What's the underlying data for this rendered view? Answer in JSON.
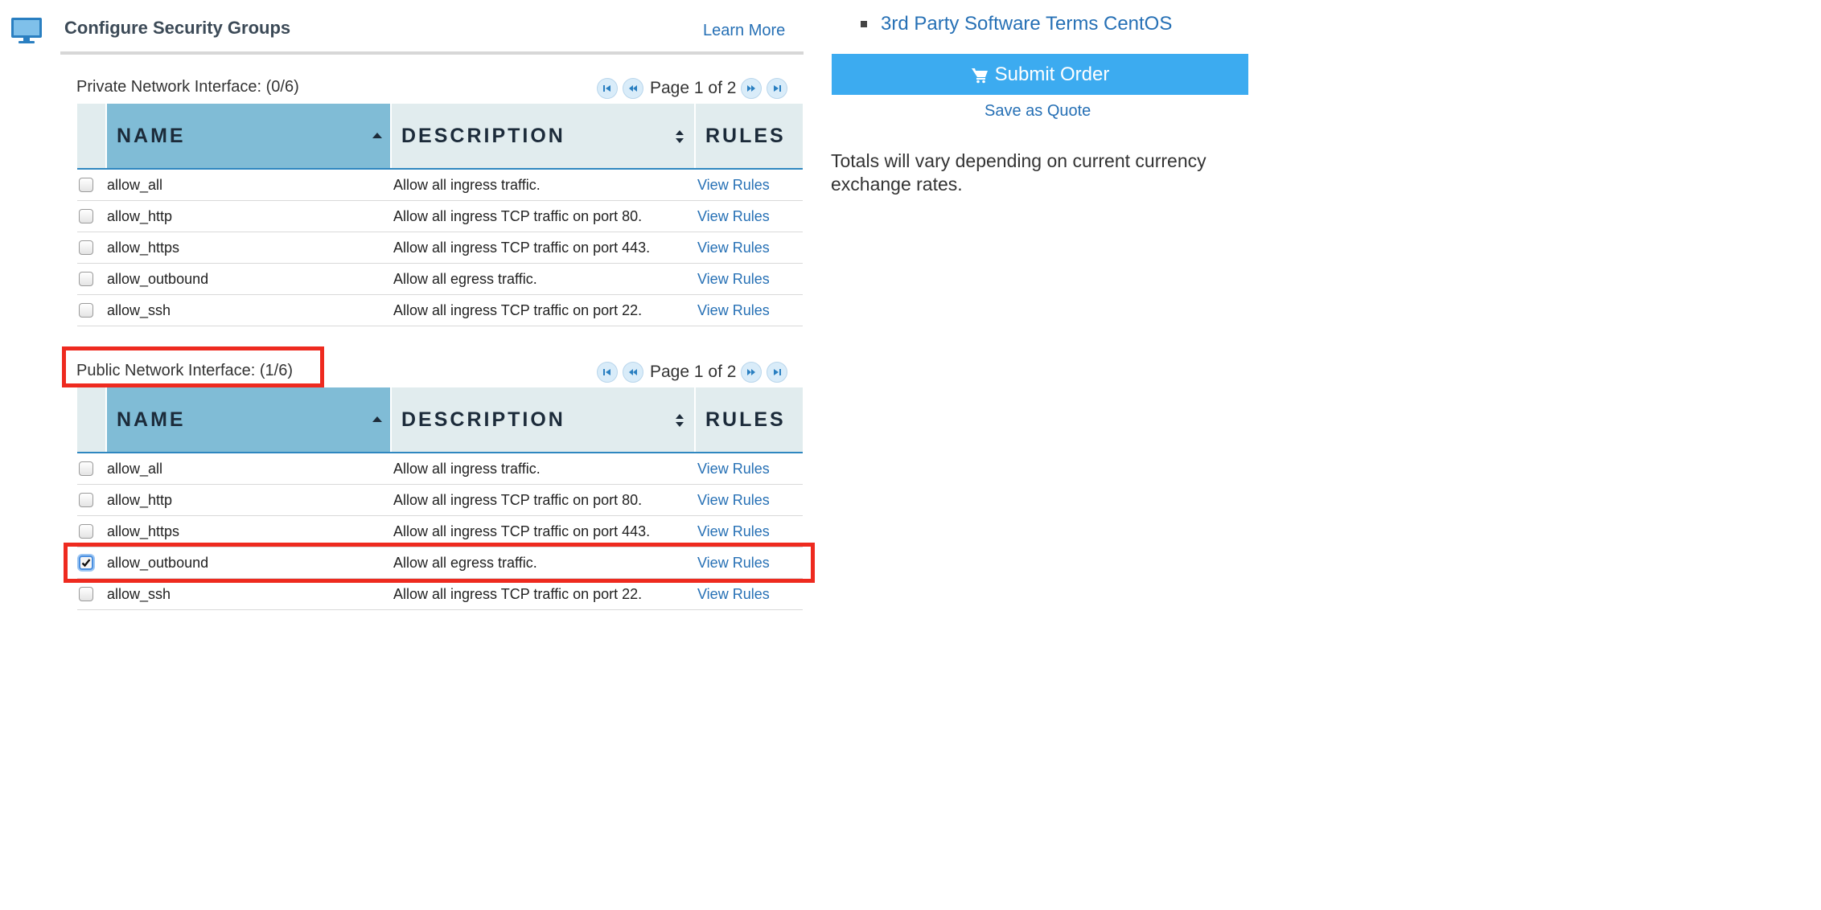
{
  "section": {
    "title": "Configure Security Groups",
    "learn_more": "Learn More"
  },
  "private": {
    "label": "Private Network Interface: (0/6)",
    "page_label": "Page 1 of 2",
    "columns": {
      "name": "NAME",
      "description": "DESCRIPTION",
      "rules": "RULES"
    },
    "rows": [
      {
        "name": "allow_all",
        "description": "Allow all ingress traffic.",
        "rules": "View Rules",
        "checked": false
      },
      {
        "name": "allow_http",
        "description": "Allow all ingress TCP traffic on port 80.",
        "rules": "View Rules",
        "checked": false
      },
      {
        "name": "allow_https",
        "description": "Allow all ingress TCP traffic on port 443.",
        "rules": "View Rules",
        "checked": false
      },
      {
        "name": "allow_outbound",
        "description": "Allow all egress traffic.",
        "rules": "View Rules",
        "checked": false
      },
      {
        "name": "allow_ssh",
        "description": "Allow all ingress TCP traffic on port 22.",
        "rules": "View Rules",
        "checked": false
      }
    ]
  },
  "public": {
    "label": "Public Network Interface: (1/6)",
    "page_label": "Page 1 of 2",
    "columns": {
      "name": "NAME",
      "description": "DESCRIPTION",
      "rules": "RULES"
    },
    "rows": [
      {
        "name": "allow_all",
        "description": "Allow all ingress traffic.",
        "rules": "View Rules",
        "checked": false
      },
      {
        "name": "allow_http",
        "description": "Allow all ingress TCP traffic on port 80.",
        "rules": "View Rules",
        "checked": false
      },
      {
        "name": "allow_https",
        "description": "Allow all ingress TCP traffic on port 443.",
        "rules": "View Rules",
        "checked": false
      },
      {
        "name": "allow_outbound",
        "description": "Allow all egress traffic.",
        "rules": "View Rules",
        "checked": true
      },
      {
        "name": "allow_ssh",
        "description": "Allow all ingress TCP traffic on port 22.",
        "rules": "View Rules",
        "checked": false
      }
    ]
  },
  "sidebar": {
    "terms_link": "3rd Party Software Terms CentOS",
    "submit_label": "Submit Order",
    "quote_label": "Save as Quote",
    "totals_note": "Totals will vary depending on current currency exchange rates."
  },
  "colors": {
    "link": "#2670b5",
    "submit_bg": "#3cabf0",
    "active_header": "#80bcd6",
    "highlight": "#ee2a1f"
  }
}
